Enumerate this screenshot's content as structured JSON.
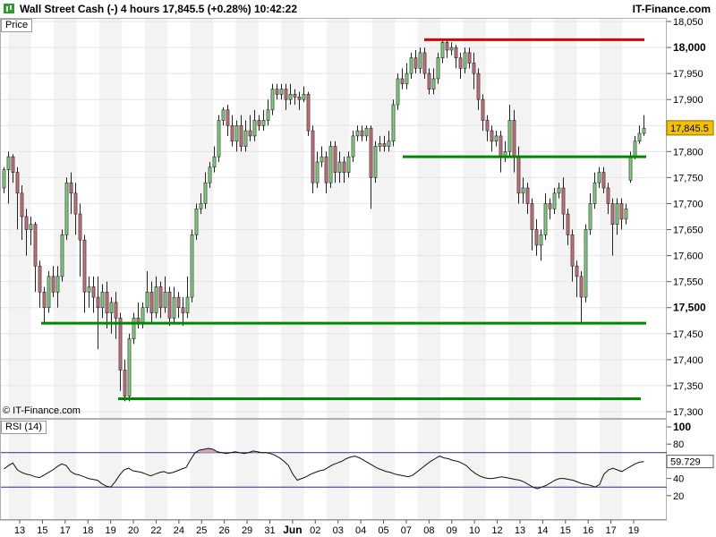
{
  "header": {
    "title": "Wall Street Cash (-)   4 hours   17,845.5 (+0.28%)   10:42:22",
    "brand": "IT-Finance.com"
  },
  "panels": {
    "price_label": "Price",
    "rsi_label": "RSI (14)",
    "copyright": "© IT-Finance.com"
  },
  "colors": {
    "up_candle": "#7ed07e",
    "down_candle": "#c8707a",
    "support_lines": "#008800",
    "resistance_line": "#e00000",
    "rsi_band": "#2a2aa0",
    "price_badge": "#f2c200"
  },
  "chart_data": [
    {
      "type": "candlestick",
      "ylim": [
        17300,
        18050
      ],
      "y_ticks": [
        "18,050",
        "18,000",
        "17,950",
        "17,900",
        "17,850",
        "17,800",
        "17,750",
        "17,700",
        "17,650",
        "17,600",
        "17,550",
        "17,500",
        "17,450",
        "17,400",
        "17,350",
        "17,300"
      ],
      "bold_ticks": [
        "18,000",
        "17,500"
      ],
      "x_ticks": [
        "13",
        "15",
        "17",
        "18",
        "19",
        "20",
        "22",
        "24",
        "25",
        "26",
        "29",
        "31",
        "Jun",
        "02",
        "03",
        "04",
        "05",
        "07",
        "08",
        "09",
        "10",
        "12",
        "13",
        "14",
        "15",
        "16",
        "17",
        "19"
      ],
      "last_price": "17,845.5",
      "candles": [
        [
          17730,
          17765,
          17720,
          17770
        ],
        [
          17765,
          17790,
          17700,
          17800
        ],
        [
          17790,
          17760,
          17740,
          17795
        ],
        [
          17760,
          17720,
          17650,
          17770
        ],
        [
          17720,
          17675,
          17630,
          17735
        ],
        [
          17675,
          17650,
          17600,
          17690
        ],
        [
          17650,
          17660,
          17620,
          17675
        ],
        [
          17660,
          17580,
          17530,
          17665
        ],
        [
          17580,
          17530,
          17500,
          17590
        ],
        [
          17530,
          17500,
          17470,
          17540
        ],
        [
          17500,
          17560,
          17490,
          17570
        ],
        [
          17560,
          17530,
          17520,
          17580
        ],
        [
          17530,
          17560,
          17500,
          17580
        ],
        [
          17560,
          17640,
          17550,
          17650
        ],
        [
          17640,
          17740,
          17630,
          17750
        ],
        [
          17740,
          17720,
          17680,
          17760
        ],
        [
          17720,
          17680,
          17640,
          17740
        ],
        [
          17680,
          17630,
          17560,
          17700
        ],
        [
          17630,
          17530,
          17490,
          17640
        ],
        [
          17530,
          17540,
          17500,
          17560
        ],
        [
          17540,
          17520,
          17490,
          17560
        ],
        [
          17520,
          17500,
          17420,
          17560
        ],
        [
          17500,
          17530,
          17480,
          17545
        ],
        [
          17530,
          17490,
          17460,
          17550
        ],
        [
          17490,
          17510,
          17450,
          17520
        ],
        [
          17510,
          17480,
          17440,
          17530
        ],
        [
          17480,
          17380,
          17340,
          17490
        ],
        [
          17380,
          17330,
          17320,
          17400
        ],
        [
          17330,
          17440,
          17320,
          17450
        ],
        [
          17440,
          17480,
          17430,
          17490
        ],
        [
          17480,
          17470,
          17460,
          17510
        ],
        [
          17470,
          17500,
          17460,
          17510
        ],
        [
          17500,
          17530,
          17490,
          17570
        ],
        [
          17530,
          17490,
          17470,
          17550
        ],
        [
          17490,
          17540,
          17480,
          17560
        ],
        [
          17540,
          17500,
          17480,
          17550
        ],
        [
          17500,
          17530,
          17490,
          17560
        ],
        [
          17530,
          17480,
          17465,
          17540
        ],
        [
          17480,
          17520,
          17470,
          17540
        ],
        [
          17520,
          17500,
          17480,
          17530
        ],
        [
          17500,
          17490,
          17465,
          17520
        ],
        [
          17490,
          17520,
          17480,
          17560
        ],
        [
          17520,
          17640,
          17510,
          17650
        ],
        [
          17640,
          17690,
          17630,
          17700
        ],
        [
          17690,
          17700,
          17680,
          17720
        ],
        [
          17700,
          17740,
          17690,
          17760
        ],
        [
          17740,
          17770,
          17730,
          17780
        ],
        [
          17770,
          17790,
          17760,
          17810
        ],
        [
          17790,
          17860,
          17780,
          17870
        ],
        [
          17860,
          17880,
          17850,
          17885
        ],
        [
          17880,
          17850,
          17830,
          17890
        ],
        [
          17850,
          17820,
          17810,
          17870
        ],
        [
          17820,
          17850,
          17800,
          17860
        ],
        [
          17850,
          17810,
          17800,
          17870
        ],
        [
          17810,
          17840,
          17800,
          17860
        ],
        [
          17840,
          17830,
          17820,
          17870
        ],
        [
          17830,
          17860,
          17820,
          17880
        ],
        [
          17860,
          17850,
          17840,
          17870
        ],
        [
          17850,
          17860,
          17840,
          17880
        ],
        [
          17860,
          17880,
          17850,
          17900
        ],
        [
          17880,
          17920,
          17870,
          17930
        ],
        [
          17920,
          17910,
          17900,
          17930
        ],
        [
          17910,
          17920,
          17900,
          17930
        ],
        [
          17920,
          17900,
          17880,
          17930
        ],
        [
          17900,
          17910,
          17890,
          17930
        ],
        [
          17910,
          17905,
          17890,
          17920
        ],
        [
          17905,
          17900,
          17880,
          17915
        ],
        [
          17900,
          17910,
          17895,
          17925
        ],
        [
          17910,
          17840,
          17830,
          17915
        ],
        [
          17840,
          17740,
          17720,
          17850
        ],
        [
          17740,
          17780,
          17730,
          17800
        ],
        [
          17780,
          17790,
          17770,
          17810
        ],
        [
          17790,
          17740,
          17720,
          17800
        ],
        [
          17740,
          17810,
          17730,
          17820
        ],
        [
          17810,
          17760,
          17740,
          17820
        ],
        [
          17760,
          17780,
          17740,
          17800
        ],
        [
          17780,
          17760,
          17740,
          17790
        ],
        [
          17760,
          17790,
          17750,
          17800
        ],
        [
          17790,
          17830,
          17780,
          17840
        ],
        [
          17830,
          17840,
          17820,
          17850
        ],
        [
          17840,
          17830,
          17820,
          17850
        ],
        [
          17830,
          17845,
          17820,
          17850
        ],
        [
          17845,
          17750,
          17690,
          17850
        ],
        [
          17750,
          17810,
          17740,
          17820
        ],
        [
          17810,
          17815,
          17800,
          17830
        ],
        [
          17815,
          17810,
          17800,
          17830
        ],
        [
          17810,
          17820,
          17800,
          17840
        ],
        [
          17820,
          17890,
          17810,
          17900
        ],
        [
          17890,
          17940,
          17880,
          17950
        ],
        [
          17940,
          17930,
          17920,
          17960
        ],
        [
          17930,
          17950,
          17920,
          17970
        ],
        [
          17950,
          17980,
          17940,
          17990
        ],
        [
          17980,
          17960,
          17950,
          17995
        ],
        [
          17960,
          17990,
          17950,
          18000
        ],
        [
          17990,
          17950,
          17940,
          18000
        ],
        [
          17950,
          17920,
          17910,
          17960
        ],
        [
          17920,
          17940,
          17910,
          17960
        ],
        [
          17940,
          17980,
          17930,
          17990
        ],
        [
          17980,
          18010,
          17970,
          18015
        ],
        [
          18010,
          17995,
          17980,
          18015
        ],
        [
          17995,
          18000,
          17985,
          18010
        ],
        [
          18000,
          17980,
          17960,
          18005
        ],
        [
          17980,
          17960,
          17940,
          17990
        ],
        [
          17960,
          17990,
          17950,
          18000
        ],
        [
          17990,
          17970,
          17960,
          18000
        ],
        [
          17970,
          17950,
          17920,
          17990
        ],
        [
          17950,
          17900,
          17880,
          17960
        ],
        [
          17900,
          17860,
          17840,
          17910
        ],
        [
          17860,
          17840,
          17820,
          17870
        ],
        [
          17840,
          17820,
          17800,
          17850
        ],
        [
          17820,
          17830,
          17810,
          17840
        ],
        [
          17830,
          17790,
          17760,
          17840
        ],
        [
          17790,
          17800,
          17780,
          17820
        ],
        [
          17800,
          17860,
          17790,
          17890
        ],
        [
          17860,
          17790,
          17760,
          17880
        ],
        [
          17790,
          17720,
          17700,
          17810
        ],
        [
          17720,
          17730,
          17700,
          17750
        ],
        [
          17730,
          17700,
          17680,
          17740
        ],
        [
          17700,
          17650,
          17610,
          17710
        ],
        [
          17650,
          17620,
          17600,
          17670
        ],
        [
          17620,
          17640,
          17590,
          17650
        ],
        [
          17640,
          17700,
          17630,
          17720
        ],
        [
          17700,
          17690,
          17670,
          17710
        ],
        [
          17690,
          17720,
          17680,
          17730
        ],
        [
          17720,
          17730,
          17710,
          17740
        ],
        [
          17730,
          17680,
          17650,
          17750
        ],
        [
          17680,
          17640,
          17620,
          17690
        ],
        [
          17640,
          17580,
          17550,
          17650
        ],
        [
          17580,
          17560,
          17520,
          17590
        ],
        [
          17560,
          17520,
          17470,
          17570
        ],
        [
          17520,
          17650,
          17510,
          17660
        ],
        [
          17650,
          17700,
          17640,
          17720
        ],
        [
          17700,
          17740,
          17690,
          17760
        ],
        [
          17740,
          17760,
          17730,
          17770
        ],
        [
          17760,
          17730,
          17720,
          17770
        ],
        [
          17730,
          17700,
          17680,
          17740
        ],
        [
          17700,
          17660,
          17600,
          17710
        ],
        [
          17660,
          17700,
          17640,
          17710
        ],
        [
          17700,
          17670,
          17650,
          17710
        ],
        [
          17670,
          17690,
          17660,
          17700
        ],
        [
          17745,
          17790,
          17740,
          17800
        ],
        [
          17790,
          17820,
          17785,
          17830
        ],
        [
          17820,
          17835,
          17815,
          17850
        ],
        [
          17835,
          17845,
          17830,
          17870
        ]
      ],
      "levels": [
        {
          "kind": "resistance",
          "value": 18015
        },
        {
          "kind": "support",
          "value": 17790
        },
        {
          "kind": "support",
          "value": 17470
        },
        {
          "kind": "support",
          "value": 17325
        }
      ]
    },
    {
      "type": "line",
      "ylim": [
        0,
        100
      ],
      "y_ticks": [
        "100",
        "80",
        "60",
        "40",
        "20"
      ],
      "bands": [
        70,
        30
      ],
      "last_value": "59.729",
      "values": [
        51,
        55,
        58,
        50,
        47,
        45,
        44,
        42,
        41,
        44,
        47,
        50,
        54,
        57,
        55,
        48,
        45,
        44,
        42,
        40,
        39,
        38,
        34,
        31,
        30,
        36,
        44,
        50,
        52,
        49,
        48,
        47,
        45,
        43,
        45,
        47,
        48,
        46,
        47,
        49,
        51,
        53,
        62,
        70,
        73,
        74,
        75,
        74,
        71,
        70,
        69,
        70,
        71,
        70,
        69,
        70,
        72,
        71,
        70,
        70,
        69,
        67,
        64,
        60,
        55,
        45,
        38,
        40,
        42,
        45,
        47,
        49,
        50,
        53,
        56,
        58,
        60,
        63,
        65,
        66,
        64,
        61,
        58,
        55,
        52,
        50,
        48,
        47,
        45,
        44,
        43,
        42,
        44,
        48,
        52,
        56,
        60,
        63,
        66,
        64,
        63,
        61,
        60,
        58,
        55,
        50,
        46,
        43,
        41,
        40,
        40,
        41,
        42,
        41,
        40,
        39,
        38,
        36,
        33,
        30,
        28,
        30,
        32,
        35,
        38,
        40,
        40,
        39,
        38,
        36,
        34,
        33,
        32,
        30,
        33,
        45,
        50,
        52,
        50,
        48,
        51,
        54,
        57,
        59,
        59.7
      ]
    }
  ]
}
